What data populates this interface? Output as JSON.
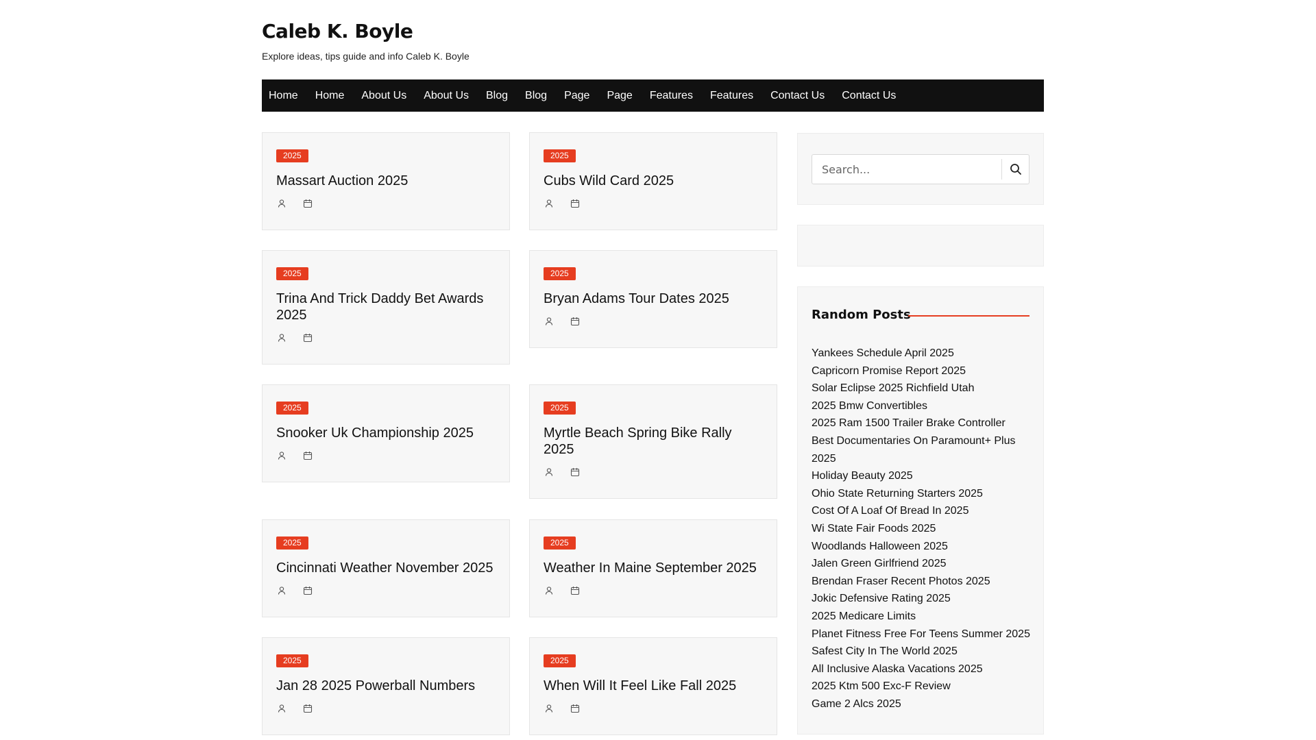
{
  "site": {
    "title": "Caleb K. Boyle",
    "tagline": "Explore ideas, tips guide and info Caleb K. Boyle"
  },
  "nav": {
    "items": [
      "Home",
      "Home",
      "About Us",
      "About Us",
      "Blog",
      "Blog",
      "Page",
      "Page",
      "Features",
      "Features",
      "Contact Us",
      "Contact Us"
    ]
  },
  "posts": [
    {
      "badge": "2025",
      "title": "Massart Auction 2025"
    },
    {
      "badge": "2025",
      "title": "Cubs Wild Card 2025"
    },
    {
      "badge": "2025",
      "title": "Trina And Trick Daddy Bet Awards 2025"
    },
    {
      "badge": "2025",
      "title": "Bryan Adams Tour Dates 2025"
    },
    {
      "badge": "2025",
      "title": "Snooker Uk Championship 2025"
    },
    {
      "badge": "2025",
      "title": "Myrtle Beach Spring Bike Rally 2025"
    },
    {
      "badge": "2025",
      "title": "Cincinnati Weather November 2025"
    },
    {
      "badge": "2025",
      "title": "Weather In Maine September 2025"
    },
    {
      "badge": "2025",
      "title": "Jan 28 2025 Powerball Numbers"
    },
    {
      "badge": "2025",
      "title": "When Will It Feel Like Fall 2025"
    }
  ],
  "icons": {
    "meta_author": "user-icon",
    "meta_date": "calendar-icon",
    "search": "search-icon"
  },
  "colors": {
    "accent": "#e63d20",
    "nav_background": "#111111"
  },
  "sidebar": {
    "search": {
      "placeholder": "Search..."
    },
    "random_posts": {
      "heading": "Random Posts",
      "items": [
        "Yankees Schedule April 2025",
        "Capricorn Promise Report 2025",
        "Solar Eclipse 2025 Richfield Utah",
        "2025 Bmw Convertibles",
        "2025 Ram 1500 Trailer Brake Controller",
        "Best Documentaries On Paramount+ Plus 2025",
        "Holiday Beauty 2025",
        "Ohio State Returning Starters 2025",
        "Cost Of A Loaf Of Bread In 2025",
        "Wi State Fair Foods 2025",
        "Woodlands Halloween 2025",
        "Jalen Green Girlfriend 2025",
        "Brendan Fraser Recent Photos 2025",
        "Jokic Defensive Rating 2025",
        "2025 Medicare Limits",
        "Planet Fitness Free For Teens Summer 2025",
        "Safest City In The World 2025",
        "All Inclusive Alaska Vacations 2025",
        "2025 Ktm 500 Exc-F Review",
        "Game 2 Alcs 2025"
      ]
    }
  }
}
